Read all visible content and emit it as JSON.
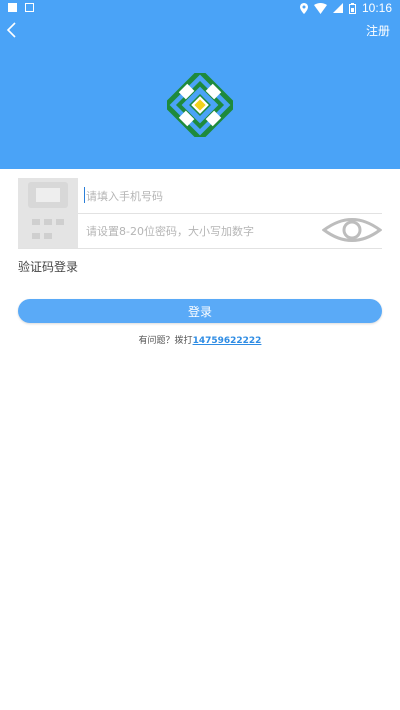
{
  "status_bar": {
    "time": "10:16",
    "icons": [
      "notification-icon",
      "download-icon",
      "location-icon",
      "wifi-icon",
      "signal-icon",
      "battery-icon"
    ]
  },
  "header": {
    "register_label": "注册",
    "background_color": "#4aa3f7"
  },
  "form": {
    "phone": {
      "value": "",
      "placeholder": "请填入手机号码"
    },
    "password": {
      "value": "",
      "placeholder": "请设置8-20位密码，大小写加数字"
    },
    "sms_login_label": "验证码登录",
    "login_button_label": "登录"
  },
  "help": {
    "prefix": "有问题？拨打",
    "phone": "14759622222"
  },
  "colors": {
    "accent": "#5aaaf7",
    "link": "#2e8ce4",
    "logo_green": "#1e8a3c"
  }
}
